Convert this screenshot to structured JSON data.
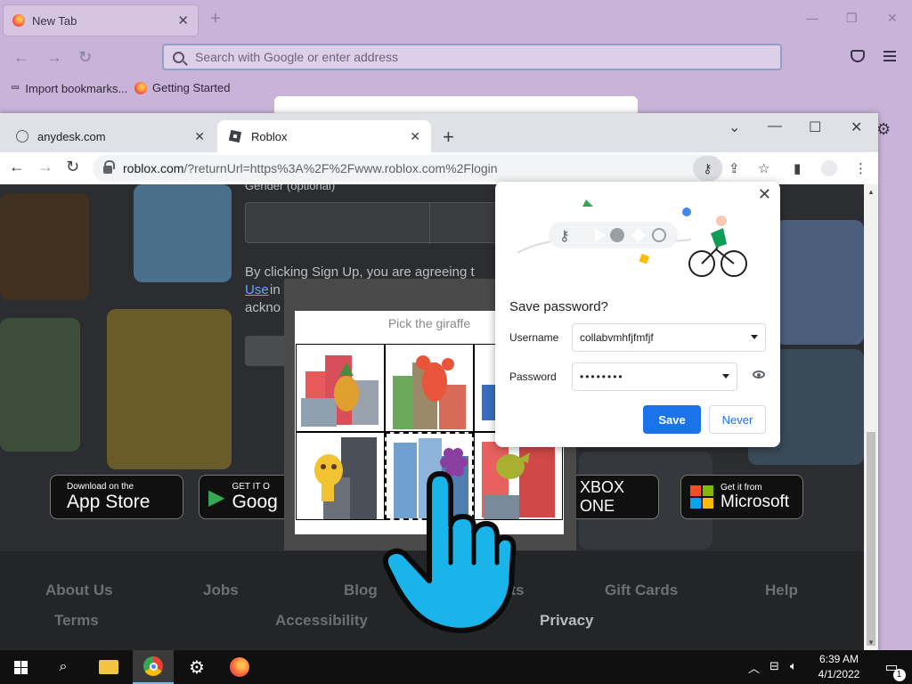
{
  "firefox": {
    "tab_title": "New Tab",
    "search_placeholder": "Search with Google or enter address",
    "bookmarks": [
      "Import bookmarks...",
      "Getting Started"
    ]
  },
  "chrome": {
    "tabs": [
      {
        "label": "anydesk.com",
        "active": false
      },
      {
        "label": "Roblox",
        "active": true
      }
    ],
    "url_main": "roblox.com",
    "url_rest": "/?returnUrl=https%3A%2F%2Fwww.roblox.com%2Flogin"
  },
  "page": {
    "gender_label": "Gender (optional)",
    "terms_line1": "By clicking Sign Up, you are agreeing t",
    "terms_use": "Use",
    "terms_in": " in",
    "terms_ackno": "ackno",
    "store_buttons": [
      {
        "small": "Download on the",
        "big": "App Store"
      },
      {
        "small": "GET IT O",
        "big": "Goog"
      },
      {
        "small": "",
        "big": "XBOX ONE"
      },
      {
        "small": "Get it from",
        "big": "Microsoft"
      }
    ],
    "footer_links": [
      "About Us",
      "Jobs",
      "Blog",
      "nts",
      "Gift Cards",
      "Help",
      "Terms",
      "Accessibility",
      "Privacy"
    ]
  },
  "captcha": {
    "prompt": "Pick the giraffe",
    "cells": [
      "pineapple",
      "lobster",
      "partial",
      "giraffe",
      "grapes",
      "dinosaur"
    ],
    "selected_index": 4
  },
  "password_popup": {
    "title": "Save password?",
    "username_label": "Username",
    "username_value": "collabvmhfjfmfjf",
    "password_label": "Password",
    "password_value": "••••••••",
    "save_label": "Save",
    "never_label": "Never"
  },
  "taskbar": {
    "time": "6:39 AM",
    "date": "4/1/2022",
    "notification_count": "1"
  },
  "colors": {
    "firefox_bg": "#c9b3d9",
    "chrome_blue": "#1a73e8",
    "taskbar": "#101010"
  }
}
